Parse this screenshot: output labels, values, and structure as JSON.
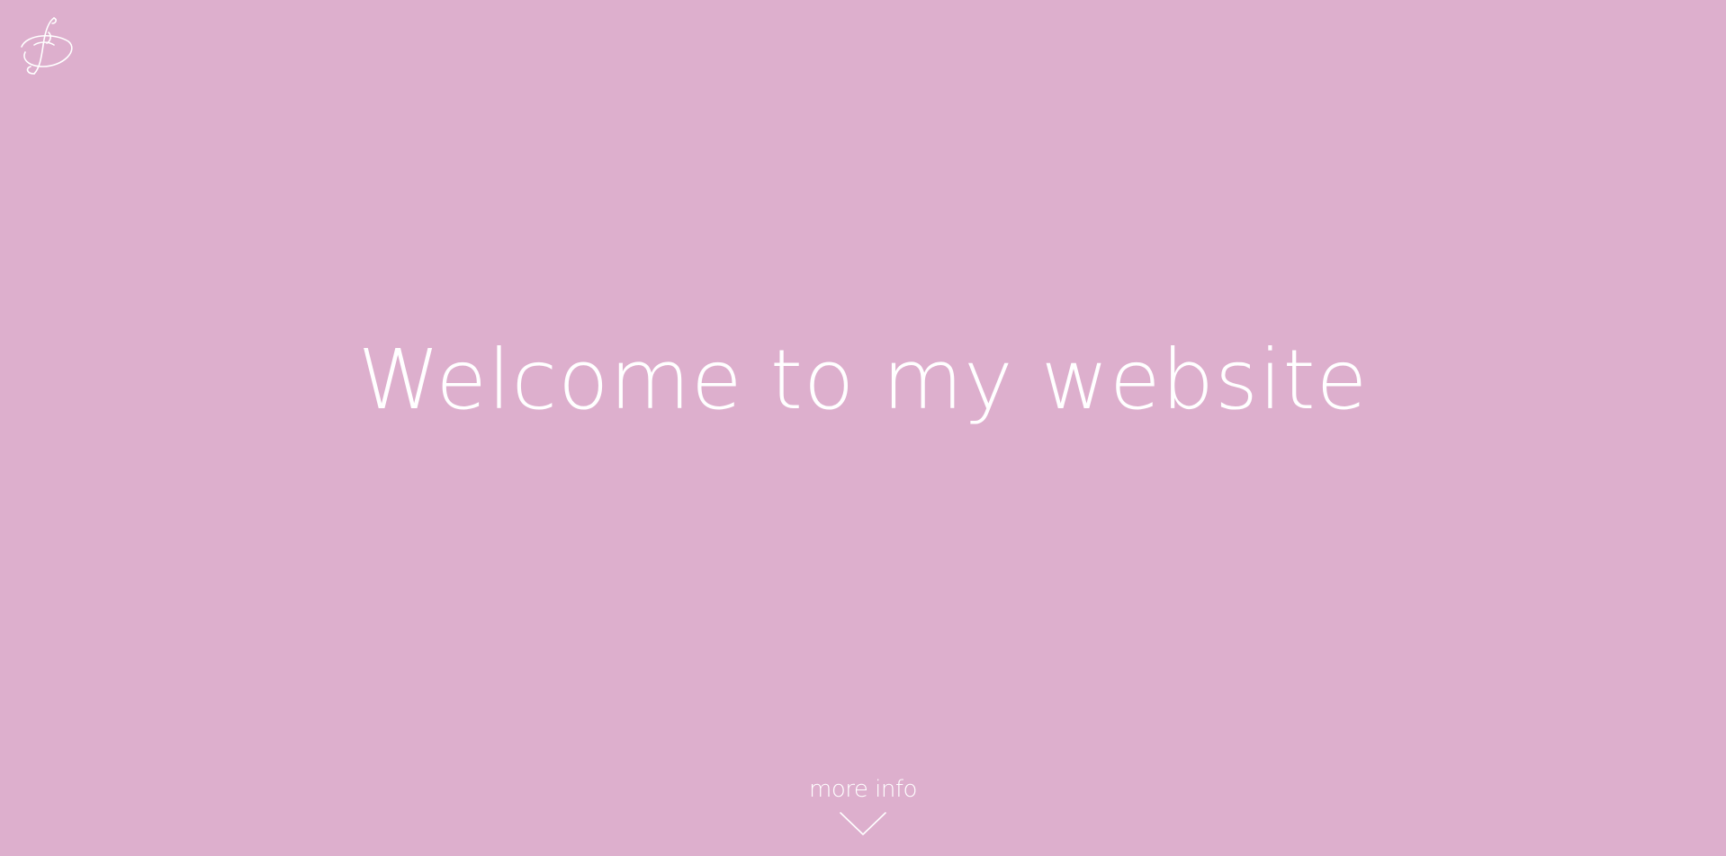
{
  "page": {
    "background_color": "#ddafcd",
    "text_color": "#ffffff"
  },
  "header": {
    "logo": {
      "icon": "monogram-logo-icon"
    }
  },
  "hero": {
    "title": "Welcome to my website"
  },
  "scroll_cue": {
    "label": "more info",
    "icon": "chevron-down-icon"
  }
}
